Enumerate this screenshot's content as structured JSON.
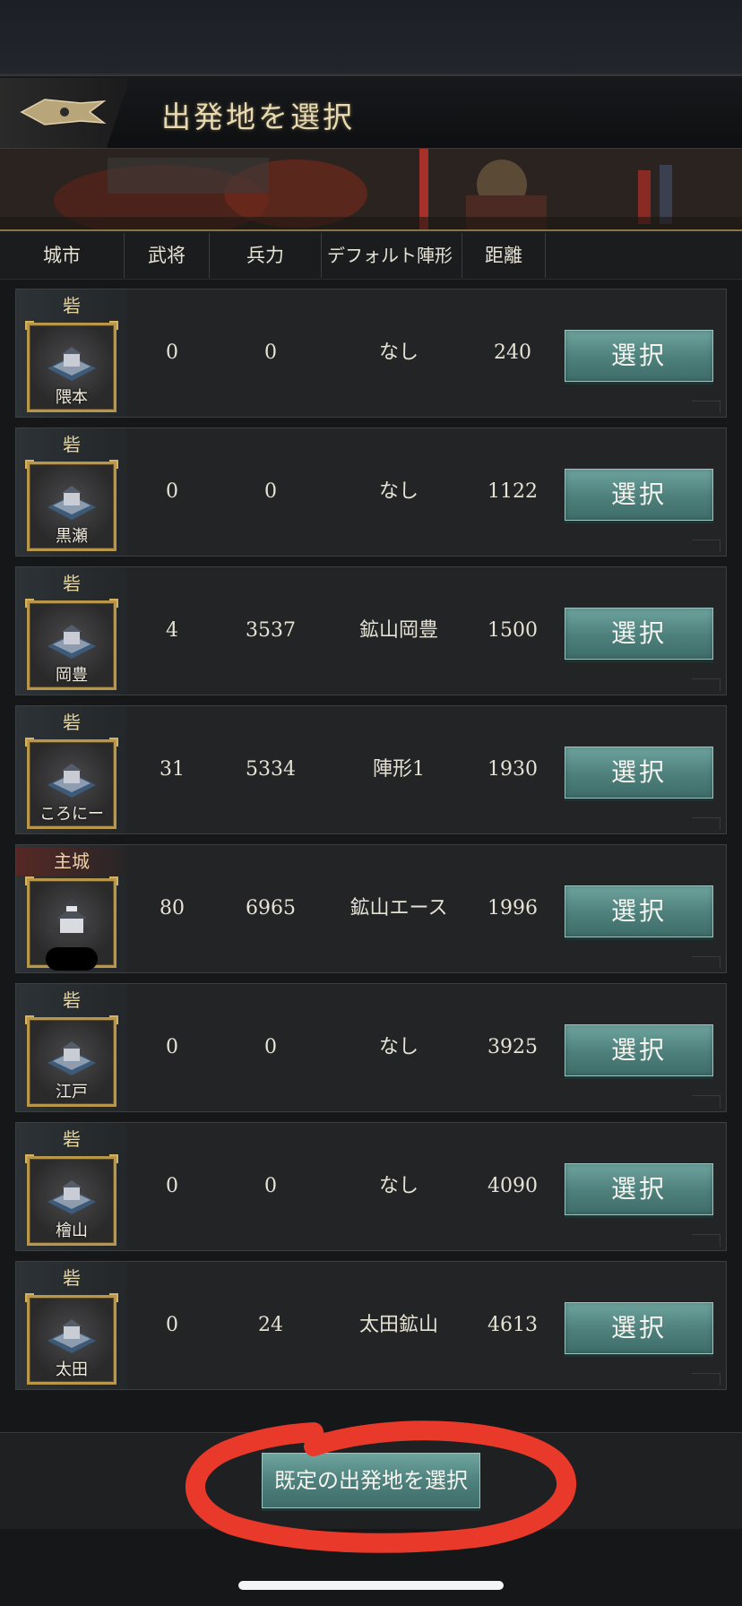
{
  "title": "出発地を選択",
  "columns": [
    "城市",
    "武将",
    "兵力",
    "デフォルト陣形",
    "距離"
  ],
  "rows": [
    {
      "type": "砦",
      "city": "隈本",
      "generals": "0",
      "troops": "0",
      "formation": "なし",
      "distance": "240",
      "button": "選択"
    },
    {
      "type": "砦",
      "city": "黒瀬",
      "generals": "0",
      "troops": "0",
      "formation": "なし",
      "distance": "1122",
      "button": "選択"
    },
    {
      "type": "砦",
      "city": "岡豊",
      "generals": "4",
      "troops": "3537",
      "formation": "鉱山岡豊",
      "distance": "1500",
      "button": "選択"
    },
    {
      "type": "砦",
      "city": "ころにー",
      "generals": "31",
      "troops": "5334",
      "formation": "陣形1",
      "distance": "1930",
      "button": "選択"
    },
    {
      "type": "主城",
      "city": "",
      "generals": "80",
      "troops": "6965",
      "formation": "鉱山エース",
      "distance": "1996",
      "button": "選択"
    },
    {
      "type": "砦",
      "city": "江戸",
      "generals": "0",
      "troops": "0",
      "formation": "なし",
      "distance": "3925",
      "button": "選択"
    },
    {
      "type": "砦",
      "city": "檜山",
      "generals": "0",
      "troops": "0",
      "formation": "なし",
      "distance": "4090",
      "button": "選択"
    },
    {
      "type": "砦",
      "city": "太田",
      "generals": "0",
      "troops": "24",
      "formation": "太田鉱山",
      "distance": "4613",
      "button": "選択"
    }
  ],
  "footer": {
    "default_button": "既定の出発地を選択"
  },
  "colors": {
    "accent_button": "#4d7f7b",
    "annotation": "#e8392a",
    "frame_gold": "#b8964a"
  }
}
